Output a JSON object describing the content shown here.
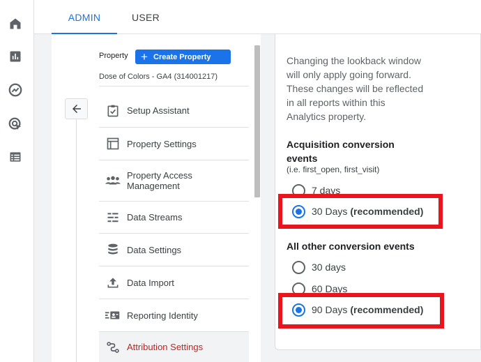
{
  "rail": {
    "items": [
      {
        "icon": "home-icon"
      },
      {
        "icon": "bar-chart-icon"
      },
      {
        "icon": "explore-icon"
      },
      {
        "icon": "advertising-icon"
      },
      {
        "icon": "list-icon"
      }
    ]
  },
  "tabs": [
    {
      "label": "ADMIN",
      "active": true
    },
    {
      "label": "USER",
      "active": false
    }
  ],
  "property": {
    "label": "Property",
    "create_button": "Create Property",
    "name": "Dose of Colors - GA4 (314001217)"
  },
  "nav": {
    "items": [
      {
        "label": "Setup Assistant",
        "icon": "checklist-icon"
      },
      {
        "label": "Property Settings",
        "icon": "property-settings-icon"
      },
      {
        "label": "Property Access Management",
        "icon": "people-icon"
      },
      {
        "label": "Data Streams",
        "icon": "data-streams-icon"
      },
      {
        "label": "Data Settings",
        "icon": "database-icon"
      },
      {
        "label": "Data Import",
        "icon": "upload-icon"
      },
      {
        "label": "Reporting Identity",
        "icon": "reporting-identity-icon"
      },
      {
        "label": "Attribution Settings",
        "icon": "attribution-icon",
        "active": true
      }
    ]
  },
  "panel": {
    "description": "Changing the lookback window will only apply going forward. These changes will be reflected in all reports within this Analytics property.",
    "acquisition": {
      "title": "Acquisition conversion events",
      "hint": "(i.e. first_open, first_visit)",
      "options": [
        {
          "label": "7 days",
          "suffix": "",
          "selected": false
        },
        {
          "label": "30 Days",
          "suffix": "(recommended)",
          "selected": true
        }
      ]
    },
    "other": {
      "title": "All other conversion events",
      "options": [
        {
          "label": "30 days",
          "suffix": "",
          "selected": false
        },
        {
          "label": "60 Days",
          "suffix": "",
          "selected": false
        },
        {
          "label": "90 Days",
          "suffix": "(recommended)",
          "selected": true
        }
      ]
    }
  },
  "colors": {
    "accent": "#1a73e8",
    "active_nav_text": "#c5221f",
    "highlight_box": "#e8141e"
  }
}
